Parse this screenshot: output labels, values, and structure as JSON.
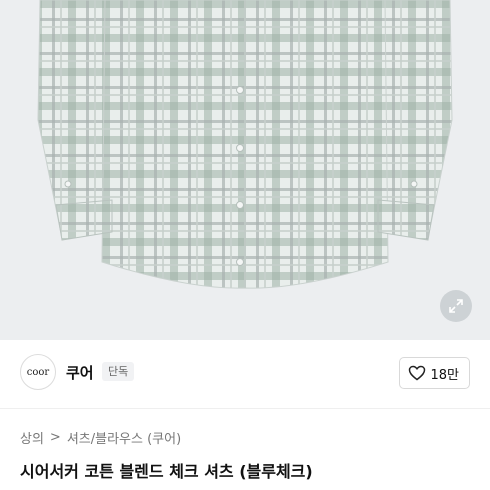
{
  "brand": {
    "logo_text": "coor",
    "name": "쿠어",
    "badge": "단독",
    "like_count": "18만"
  },
  "breadcrumb": {
    "level1": "상의",
    "separator": ">",
    "level2": "셔츠/블라우스 (쿠어)"
  },
  "product": {
    "title": "시어서커 코튼 블렌드 체크 셔츠 (블루체크)"
  },
  "icons": {
    "zoom": "expand-arrows-icon",
    "like": "heart-outline-icon"
  },
  "colors": {
    "check_green": "#8fa89a",
    "check_gray": "#a9b3b0",
    "hero_bg": "#eceef0"
  }
}
